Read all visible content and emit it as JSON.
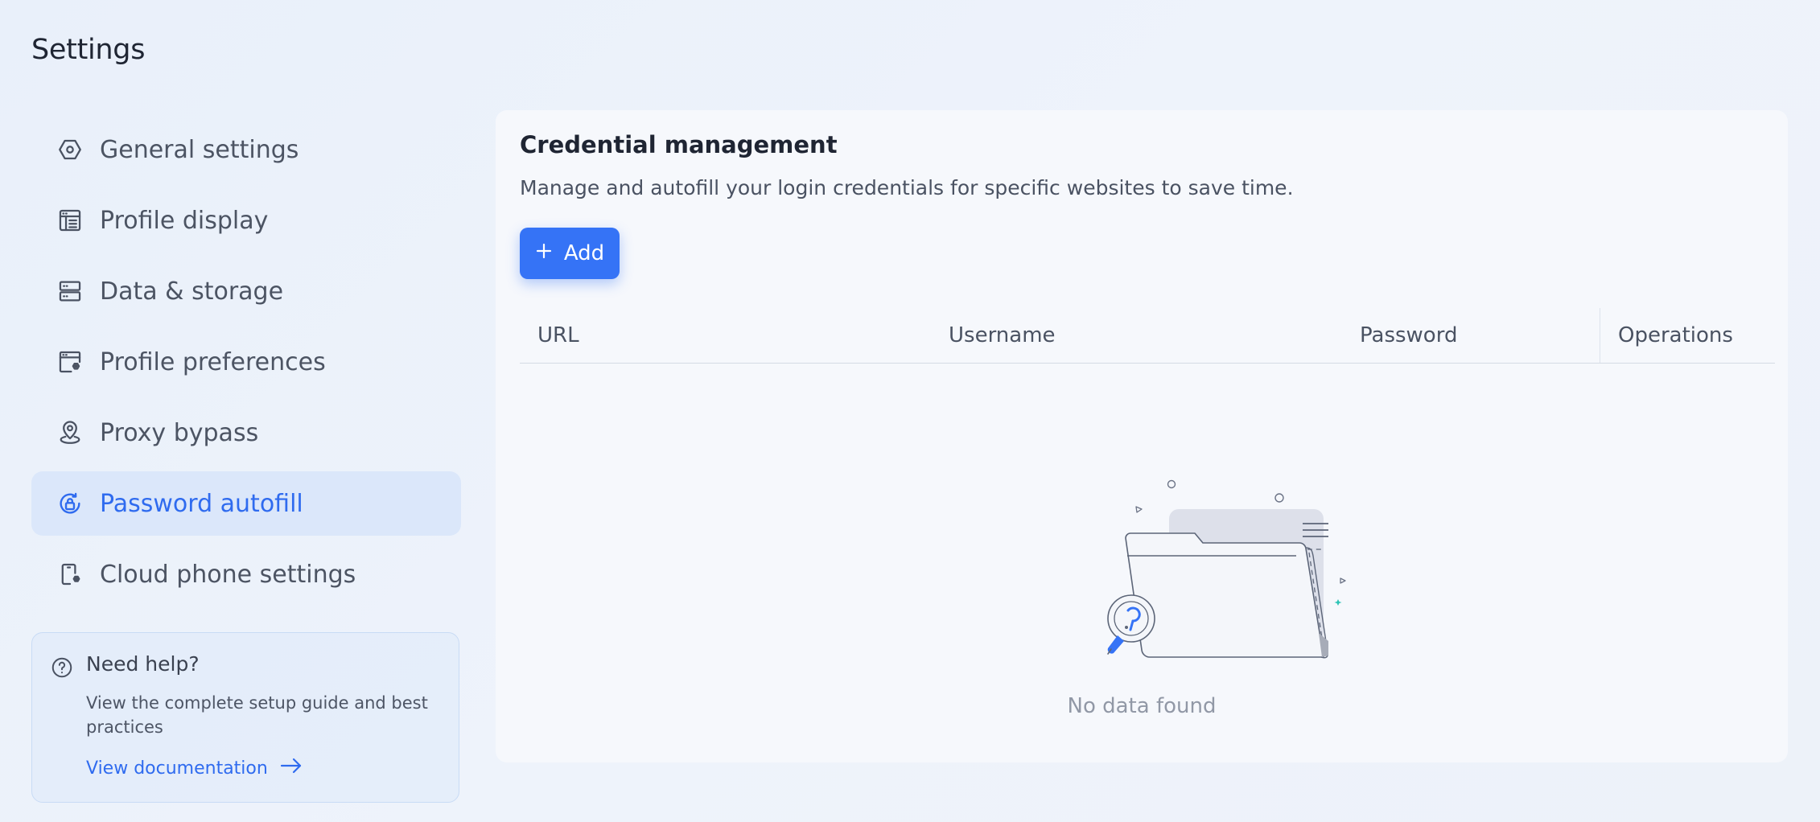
{
  "page": {
    "title": "Settings"
  },
  "sidebar": {
    "items": [
      {
        "label": "General settings",
        "icon": "hexagon-gear-icon",
        "active": false
      },
      {
        "label": "Profile display",
        "icon": "browser-window-icon",
        "active": false
      },
      {
        "label": "Data & storage",
        "icon": "server-icon",
        "active": false
      },
      {
        "label": "Profile preferences",
        "icon": "window-gear-icon",
        "active": false
      },
      {
        "label": "Proxy bypass",
        "icon": "location-pin-icon",
        "active": false
      },
      {
        "label": "Password autofill",
        "icon": "password-lock-icon",
        "active": true
      },
      {
        "label": "Cloud phone settings",
        "icon": "phone-gear-icon",
        "active": false
      }
    ]
  },
  "help": {
    "title": "Need help?",
    "description": "View the complete setup guide and best practices",
    "link_label": "View documentation",
    "icon": "question-circle-icon"
  },
  "main": {
    "title": "Credential management",
    "description": "Manage and autofill your login credentials for specific websites to save time.",
    "add_label": "Add",
    "table": {
      "columns": [
        "URL",
        "Username",
        "Password",
        "Operations"
      ],
      "rows": []
    },
    "empty_text": "No data found"
  },
  "colors": {
    "accent": "#3573f6",
    "active_bg": "#dbe7fa",
    "active_text": "#2f6bef",
    "page_bg": "#ecf2fa",
    "card_bg": "#f6f8fc"
  }
}
